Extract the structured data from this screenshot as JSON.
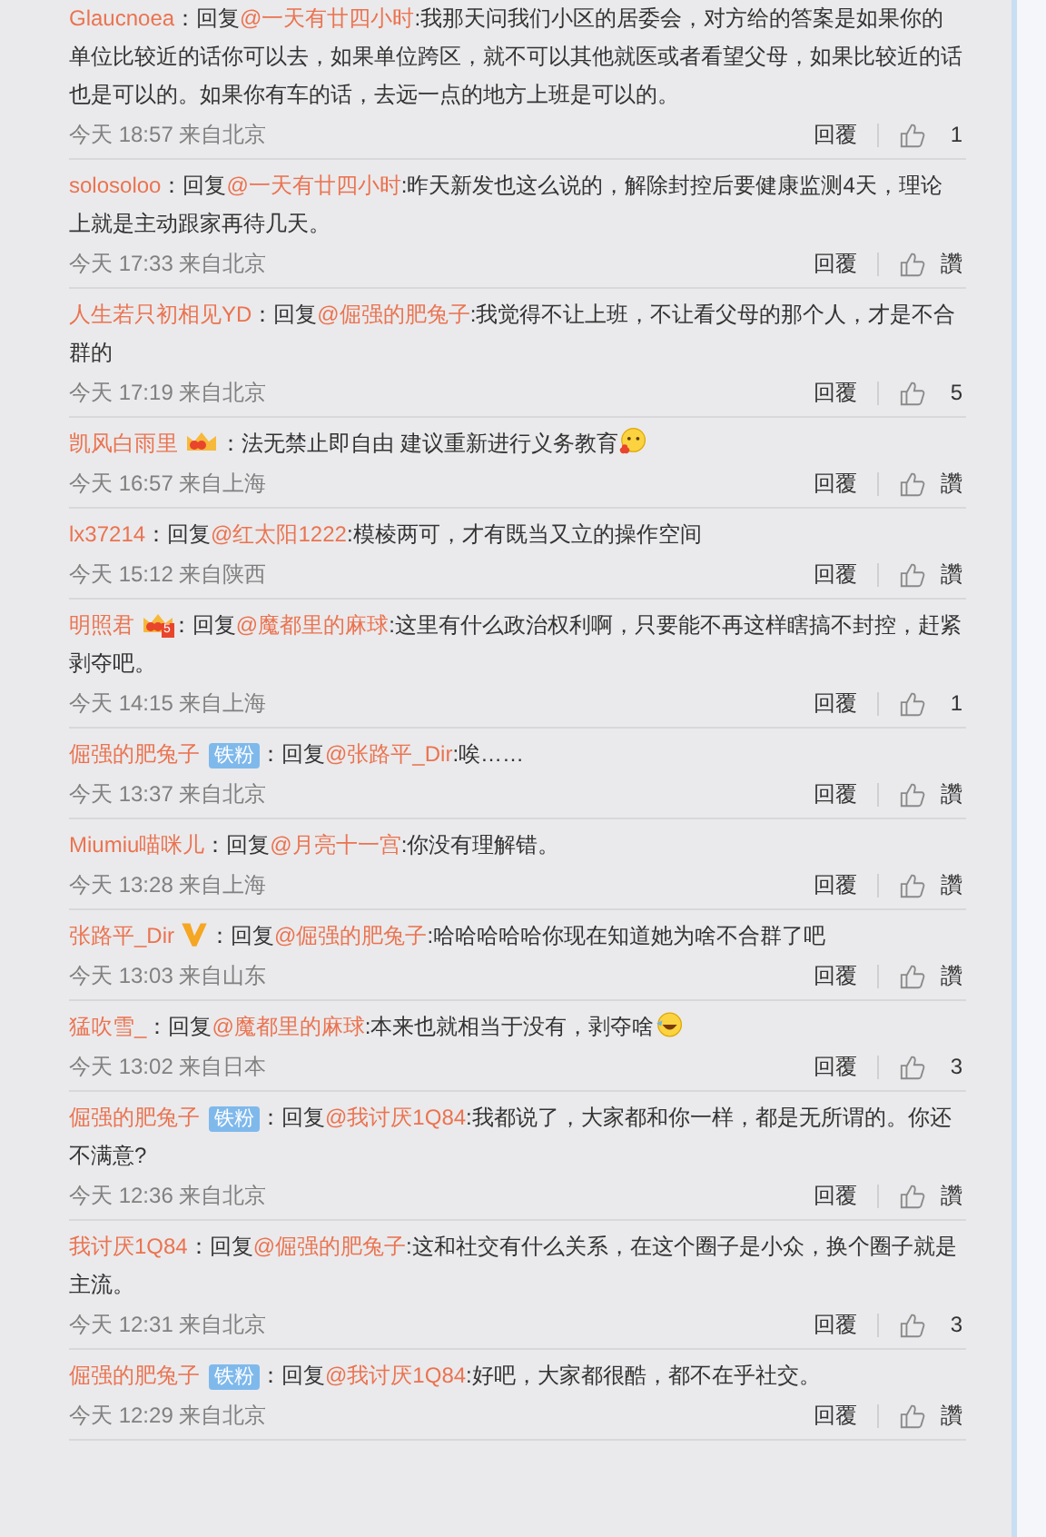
{
  "comments": [
    {
      "user": "Glaucnoea",
      "sep": "：",
      "reply": "回复",
      "mention": "@一天有廿四小时",
      "body": ":我那天问我们小区的居委会，对方给的答案是如果你的单位比较近的话你可以去，如果单位跨区，就不可以其他就医或者看望父母，如果比较近的话也是可以的。如果你有车的话，去远一点的地方上班是可以的。",
      "time": "今天 18:57 来自北京",
      "reply_button": "回覆",
      "likes": "1"
    },
    {
      "user": "solosoloo",
      "sep": "：",
      "reply": "回复",
      "mention": "@一天有廿四小时",
      "body": ":昨天新发也这么说的，解除封控后要健康监测4天，理论上就是主动跟家再待几天。",
      "time": "今天 17:33 来自北京",
      "reply_button": "回覆",
      "likes": "讚"
    },
    {
      "user": "人生若只初相见YD",
      "sep": "：",
      "reply": "回复",
      "mention": "@倔强的肥兔子",
      "body": ":我觉得不让上班，不让看父母的那个人，才是不合群的",
      "time": "今天 17:19 来自北京",
      "reply_button": "回覆",
      "likes": "5"
    },
    {
      "user": "凯风白雨里",
      "badge": {
        "kind": "vip"
      },
      "sep": "：",
      "body": "法无禁止即自由 建议重新进行义务教育",
      "emoji": {
        "kind": "kiss"
      },
      "time": "今天 16:57 来自上海",
      "reply_button": "回覆",
      "likes": "讚"
    },
    {
      "user": "lx37214",
      "sep": "：",
      "reply": "回复",
      "mention": "@红太阳1222",
      "body": ":模棱两可，才有既当又立的操作空间",
      "time": "今天 15:12 来自陕西",
      "reply_button": "回覆",
      "likes": "讚"
    },
    {
      "user": "明照君",
      "badge": {
        "kind": "vip",
        "level": "5"
      },
      "sep": "：",
      "reply": "回复",
      "mention": "@魔都里的麻球",
      "body": ":这里有什么政治权利啊，只要能不再这样瞎搞不封控，赶紧剥夺吧。",
      "time": "今天 14:15 来自上海",
      "reply_button": "回覆",
      "likes": "1"
    },
    {
      "user": "倔强的肥兔子",
      "badge": {
        "kind": "fan",
        "label": "铁粉"
      },
      "sep": "：",
      "reply": "回复",
      "mention": "@张路平_Dir",
      "body": ":唉……",
      "time": "今天 13:37 来自北京",
      "reply_button": "回覆",
      "likes": "讚"
    },
    {
      "user": "Miumiu喵咪儿",
      "sep": "：",
      "reply": "回复",
      "mention": "@月亮十一宫",
      "body": ":你没有理解错。",
      "time": "今天 13:28 来自上海",
      "reply_button": "回覆",
      "likes": "讚"
    },
    {
      "user": "张路平_Dir",
      "badge": {
        "kind": "verified"
      },
      "sep": "：",
      "reply": "回复",
      "mention": "@倔强的肥兔子",
      "body": ":哈哈哈哈哈你现在知道她为啥不合群了吧",
      "time": "今天 13:03 来自山东",
      "reply_button": "回覆",
      "likes": "讚"
    },
    {
      "user": "猛吹雪_",
      "sep": "：",
      "reply": "回复",
      "mention": "@魔都里的麻球",
      "body": ":本来也就相当于没有，剥夺啥",
      "emoji": {
        "kind": "laugh"
      },
      "time": "今天 13:02 来自日本",
      "reply_button": "回覆",
      "likes": "3"
    },
    {
      "user": "倔强的肥兔子",
      "badge": {
        "kind": "fan",
        "label": "铁粉"
      },
      "sep": "：",
      "reply": "回复",
      "mention": "@我讨厌1Q84",
      "body": ":我都说了，大家都和你一样，都是无所谓的。你还不满意?",
      "time": "今天 12:36 来自北京",
      "reply_button": "回覆",
      "likes": "讚"
    },
    {
      "user": "我讨厌1Q84",
      "sep": "：",
      "reply": "回复",
      "mention": "@倔强的肥兔子",
      "body": ":这和社交有什么关系，在这个圈子是小众，换个圈子就是主流。",
      "time": "今天 12:31 来自北京",
      "reply_button": "回覆",
      "likes": "3"
    },
    {
      "user": "倔强的肥兔子",
      "badge": {
        "kind": "fan",
        "label": "铁粉"
      },
      "sep": "：",
      "reply": "回复",
      "mention": "@我讨厌1Q84",
      "body": ":好吧，大家都很酷，都不在乎社交。",
      "time": "今天 12:29 来自北京",
      "reply_button": "回覆",
      "likes": "讚"
    }
  ]
}
